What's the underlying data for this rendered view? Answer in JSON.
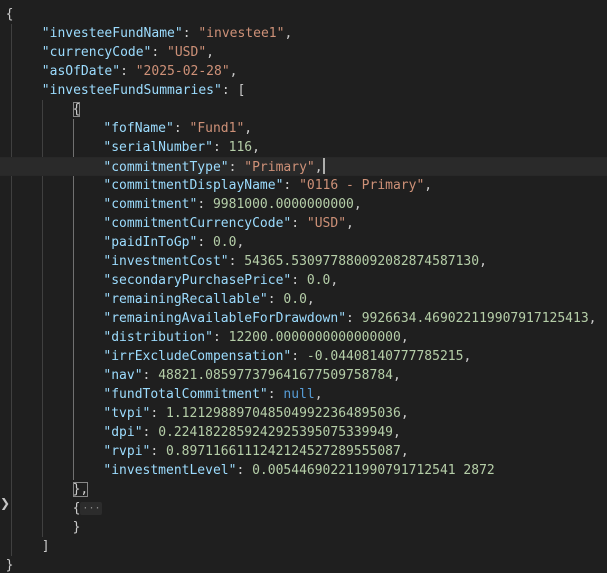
{
  "editor": {
    "open_brace": "{",
    "close_brace": "}",
    "root": [
      {
        "key": "\"investeeFundName\"",
        "value": "\"investee1\"",
        "type": "str",
        "comma": ","
      },
      {
        "key": "\"currencyCode\"",
        "value": "\"USD\"",
        "type": "str",
        "comma": ","
      },
      {
        "key": "\"asOfDate\"",
        "value": "\"2025-02-28\"",
        "type": "str",
        "comma": ","
      }
    ],
    "summaries_key": "\"investeeFundSummaries\"",
    "summaries_open": "[",
    "summaries_close": "]",
    "item_open": "{",
    "item_close": "},",
    "collapsed_open": "{",
    "collapsed_dots": "···",
    "collapsed_close": "}",
    "fields": [
      {
        "key": "\"fofName\"",
        "value": "\"Fund1\"",
        "type": "str",
        "comma": ","
      },
      {
        "key": "\"serialNumber\"",
        "value": "116",
        "type": "num",
        "comma": ","
      },
      {
        "key": "\"commitmentType\"",
        "value": "\"Primary\"",
        "type": "str",
        "comma": ","
      },
      {
        "key": "\"commitmentDisplayName\"",
        "value": "\"0116 - Primary\"",
        "type": "str",
        "comma": ","
      },
      {
        "key": "\"commitment\"",
        "value": "9981000.0000000000",
        "type": "num",
        "comma": ","
      },
      {
        "key": "\"commitmentCurrencyCode\"",
        "value": "\"USD\"",
        "type": "str",
        "comma": ","
      },
      {
        "key": "\"paidInToGp\"",
        "value": "0.0",
        "type": "num",
        "comma": ","
      },
      {
        "key": "\"investmentCost\"",
        "value": "54365.530977880092082874587130",
        "type": "num",
        "comma": ","
      },
      {
        "key": "\"secondaryPurchasePrice\"",
        "value": "0.0",
        "type": "num",
        "comma": ","
      },
      {
        "key": "\"remainingRecallable\"",
        "value": "0.0",
        "type": "num",
        "comma": ","
      },
      {
        "key": "\"remainingAvailableForDrawdown\"",
        "value": "9926634.469022119907917125413",
        "type": "num",
        "comma": ","
      },
      {
        "key": "\"distribution\"",
        "value": "12200.0000000000000000",
        "type": "num",
        "comma": ","
      },
      {
        "key": "\"irrExcludeCompensation\"",
        "value": "-0.04408140777785215",
        "type": "num",
        "comma": ","
      },
      {
        "key": "\"nav\"",
        "value": "48821.085977379641677509758784",
        "type": "num",
        "comma": ","
      },
      {
        "key": "\"fundTotalCommitment\"",
        "value": "null",
        "type": "kw",
        "comma": ","
      },
      {
        "key": "\"tvpi\"",
        "value": "1.1212988970485049922364895036",
        "type": "num",
        "comma": ","
      },
      {
        "key": "\"dpi\"",
        "value": "0.2241822859242925395075339949",
        "type": "num",
        "comma": ","
      },
      {
        "key": "\"rvpi\"",
        "value": "0.8971166111242124527289555087",
        "type": "num",
        "comma": ","
      },
      {
        "key": "\"investmentLevel\"",
        "value": "0.005446902211990791712541 2872",
        "type": "num",
        "comma": ""
      }
    ],
    "colors": {
      "background": "#1f1f1f",
      "key": "#9cdcfe",
      "string": "#ce9178",
      "number": "#b5cea8",
      "keyword": "#569cd6"
    }
  }
}
